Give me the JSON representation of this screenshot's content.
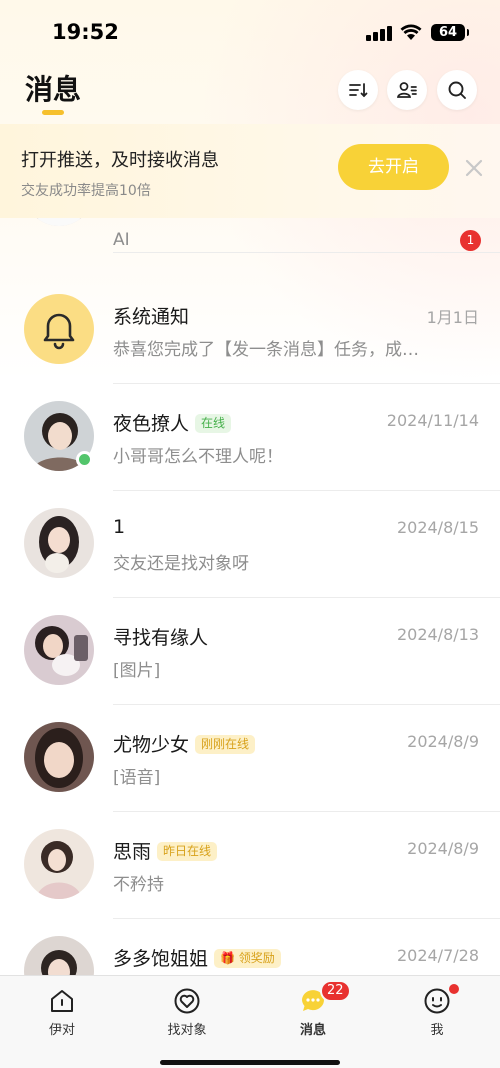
{
  "status_bar": {
    "time": "19:52",
    "battery": "64"
  },
  "header": {
    "title": "消息",
    "icons": [
      "sort-icon",
      "contacts-icon",
      "search-icon"
    ]
  },
  "banner": {
    "title": "打开推送，及时接收消息",
    "subtitle": "交友成功率提高10倍",
    "button": "去开启"
  },
  "conversations": [
    {
      "name": "",
      "message": "AI",
      "time": "",
      "unread": "1"
    },
    {
      "name": "系统通知",
      "message": "恭喜您完成了【发一条消息】任务，成…",
      "time": "1月1日"
    },
    {
      "name": "夜色撩人",
      "tag": "在线",
      "message": "小哥哥怎么不理人呢！",
      "time": "2024/11/14",
      "online": true
    },
    {
      "name": "1",
      "message": "交友还是找对象呀",
      "time": "2024/8/15"
    },
    {
      "name": "寻找有缘人",
      "message": "[图片]",
      "time": "2024/8/13"
    },
    {
      "name": "尤物少女",
      "tag": "刚刚在线",
      "message": "[语音]",
      "time": "2024/8/9"
    },
    {
      "name": "思雨",
      "tag": "昨日在线",
      "message": "不矜持",
      "time": "2024/8/9"
    },
    {
      "name": "多多饱姐姐",
      "tag": "领奖励",
      "message": "",
      "time": "2024/7/28"
    }
  ],
  "tabbar": {
    "tabs": [
      {
        "label": "伊对"
      },
      {
        "label": "找对象"
      },
      {
        "label": "消息",
        "badge": "22"
      },
      {
        "label": "我"
      }
    ]
  },
  "colors": {
    "accent": "#f8d237",
    "badge": "#e8312f",
    "online": "#52c56b"
  }
}
